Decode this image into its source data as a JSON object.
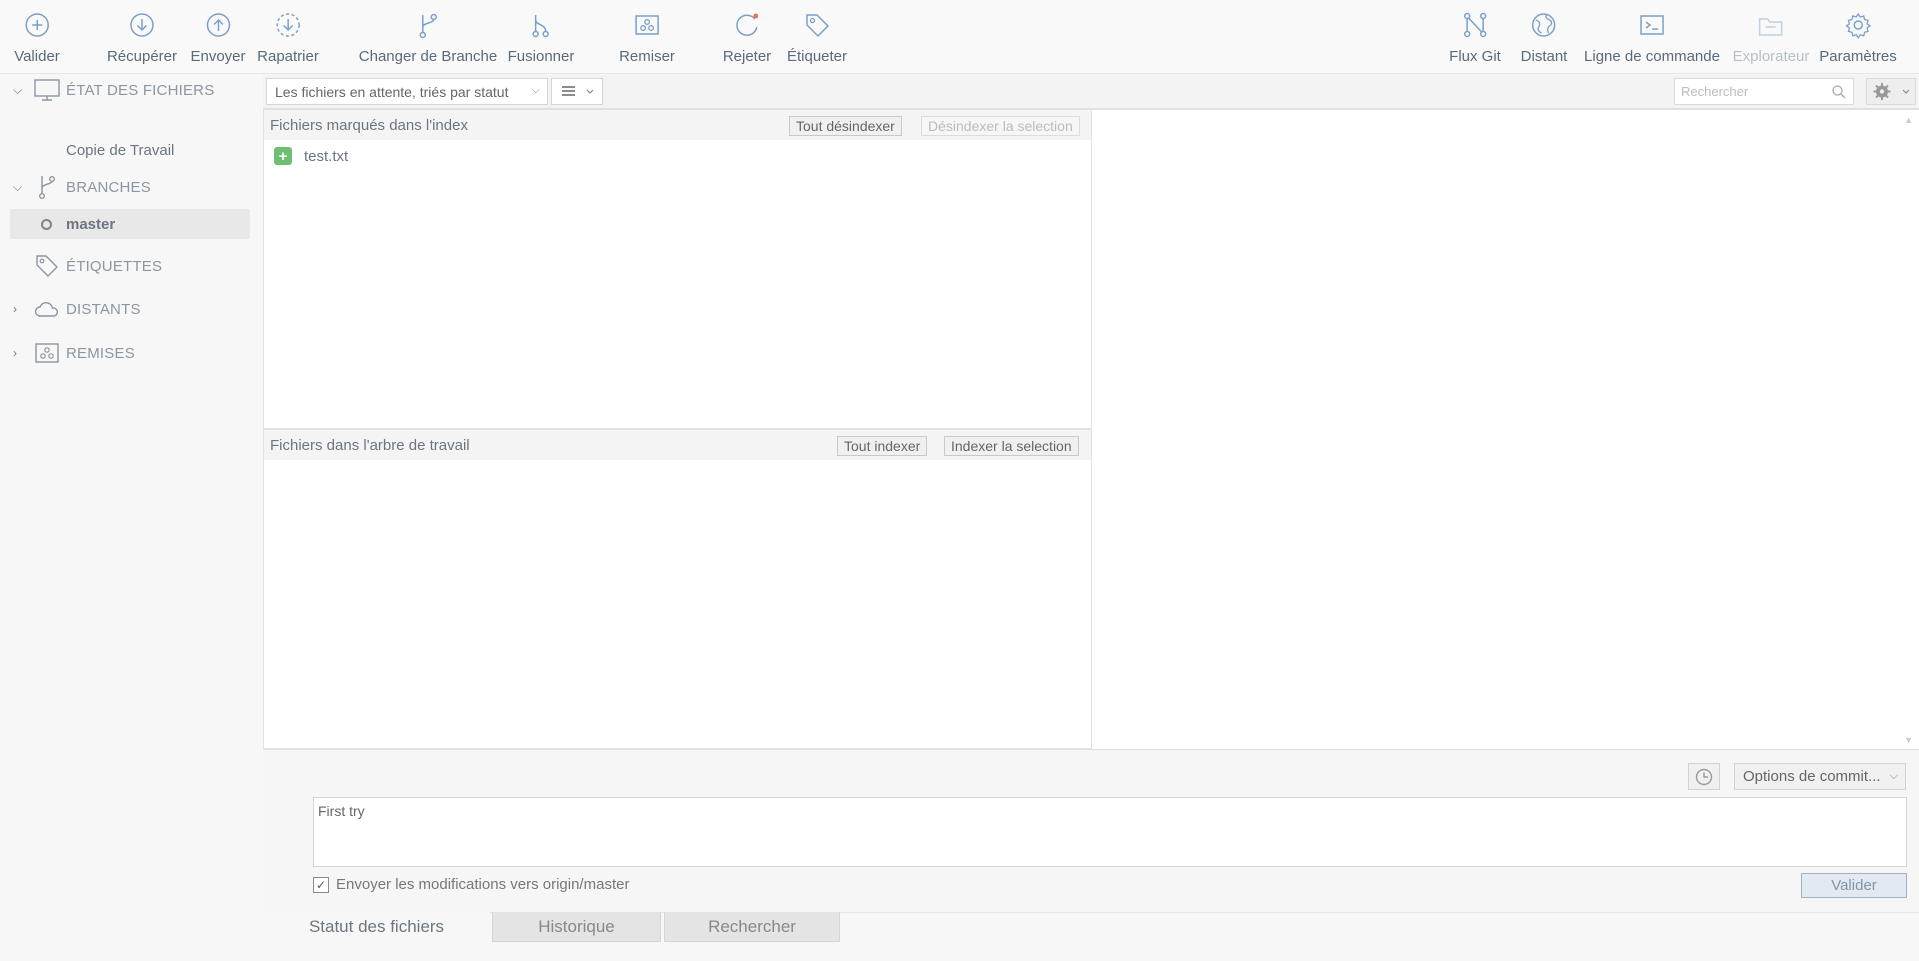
{
  "toolbar": {
    "commit": "Valider",
    "fetch": "Récupérer",
    "push": "Envoyer",
    "pull": "Rapatrier",
    "branch": "Changer de Branche",
    "merge": "Fusionner",
    "stash": "Remiser",
    "discard": "Rejeter",
    "tag": "Étiqueter",
    "git_flow": "Flux Git",
    "remote": "Distant",
    "terminal": "Ligne de commande",
    "explorer": "Explorateur",
    "settings": "Paramètres"
  },
  "sidebar": {
    "file_status": "ÉTAT DES FICHIERS",
    "working_copy": "Copie de Travail",
    "branches": "BRANCHES",
    "current_branch": "master",
    "tags": "ÉTIQUETTES",
    "remotes": "DISTANTS",
    "stashes": "REMISES"
  },
  "filter": {
    "sort_label": "Les fichiers en attente, triés par statut",
    "search_placeholder": "Rechercher"
  },
  "staged": {
    "title": "Fichiers marqués dans l'index",
    "unstage_all": "Tout désindexer",
    "unstage_selected": "Désindexer la selection",
    "files": [
      {
        "name": "test.txt",
        "status": "added"
      }
    ]
  },
  "unstaged": {
    "title": "Fichiers dans l'arbre de travail",
    "stage_all": "Tout indexer",
    "stage_selected": "Indexer la selection"
  },
  "commit": {
    "options": "Options de commit...",
    "message": "First try",
    "push_label": "Envoyer les modifications vers origin/master",
    "push_checked": true,
    "submit": "Valider"
  },
  "tabs": [
    "Statut des fichiers",
    "Historique",
    "Rechercher"
  ],
  "colors": {
    "accent": "#7aa0c8",
    "added": "#6fbf73",
    "discard_dot": "#e8735a"
  }
}
